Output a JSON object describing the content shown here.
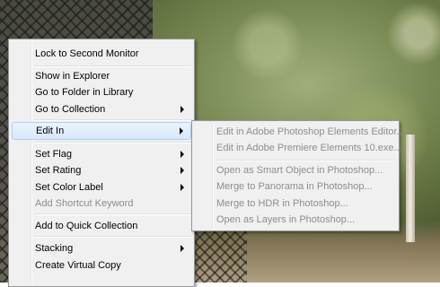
{
  "main_menu": {
    "items": [
      {
        "label": "Lock to Second Monitor",
        "enabled": true,
        "submenu": false
      },
      {
        "label": "Show in Explorer",
        "enabled": true,
        "submenu": false
      },
      {
        "label": "Go to Folder in Library",
        "enabled": true,
        "submenu": false
      },
      {
        "label": "Go to Collection",
        "enabled": true,
        "submenu": true
      },
      {
        "label": "Edit In",
        "enabled": true,
        "submenu": true,
        "highlighted": true
      },
      {
        "label": "Set Flag",
        "enabled": true,
        "submenu": true
      },
      {
        "label": "Set Rating",
        "enabled": true,
        "submenu": true
      },
      {
        "label": "Set Color Label",
        "enabled": true,
        "submenu": true
      },
      {
        "label": "Add Shortcut Keyword",
        "enabled": false,
        "submenu": false
      },
      {
        "label": "Add to Quick Collection",
        "enabled": true,
        "submenu": false
      },
      {
        "label": "Stacking",
        "enabled": true,
        "submenu": true
      },
      {
        "label": "Create Virtual Copy",
        "enabled": true,
        "submenu": false
      }
    ]
  },
  "edit_in_submenu": {
    "items": [
      {
        "label": "Edit in Adobe Photoshop Elements Editor...",
        "enabled": false
      },
      {
        "label": "Edit in Adobe Premiere Elements 10.exe...",
        "enabled": false
      },
      {
        "label": "Open as Smart Object in Photoshop...",
        "enabled": false
      },
      {
        "label": "Merge to Panorama in Photoshop...",
        "enabled": false
      },
      {
        "label": "Merge to HDR in Photoshop...",
        "enabled": false
      },
      {
        "label": "Open as Layers in Photoshop...",
        "enabled": false
      }
    ]
  }
}
